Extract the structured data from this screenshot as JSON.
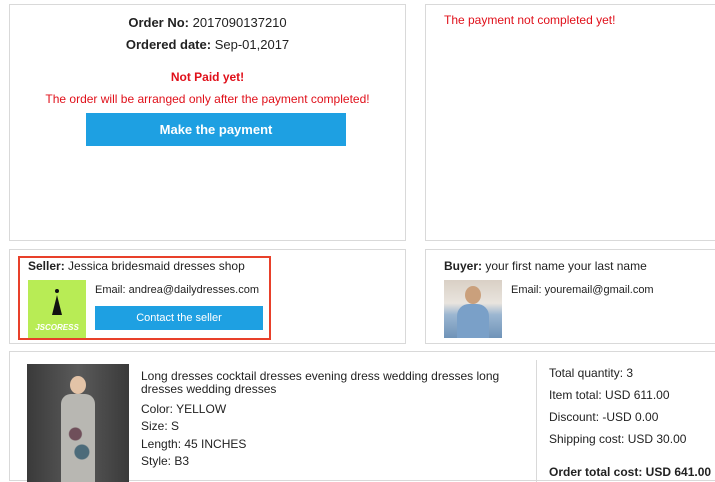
{
  "order": {
    "order_no_label": "Order No:",
    "order_no": "2017090137210",
    "ordered_date_label": "Ordered date:",
    "ordered_date": "Sep-01,2017",
    "not_paid": "Not Paid yet!",
    "arrange_note": "The order will be arranged only after the payment completed!",
    "pay_button": "Make the payment"
  },
  "status": {
    "text": "The payment not completed yet!"
  },
  "seller": {
    "label": "Seller:",
    "name": "Jessica bridesmaid dresses shop",
    "logo_text": "JSCORESS",
    "email_label": "Email:",
    "email": "andrea@dailydresses.com",
    "contact_button": "Contact the seller"
  },
  "buyer": {
    "label": "Buyer:",
    "name": "your first name your last name",
    "email_label": "Email:",
    "email": "youremail@gmail.com"
  },
  "item": {
    "title": "Long dresses cocktail dresses evening dress wedding dresses long dresses wedding dresses",
    "color": "Color: YELLOW",
    "size": "Size: S",
    "length": "Length: 45 INCHES",
    "style": "Style: B3"
  },
  "summary": {
    "total_quantity": "Total quantity: 3",
    "item_total": "Item total: USD 611.00",
    "discount": "Discount: -USD 0.00",
    "shipping_cost": "Shipping cost: USD 30.00",
    "order_total": "Order total cost: USD 641.00"
  },
  "colors": {
    "accent": "#1ea0e2",
    "alert": "#e0101a",
    "highlight_border": "#e8402a",
    "seller_logo_bg": "#b8ec55"
  },
  "icons": {
    "seller_logo": "dress-silhouette-logo",
    "buyer_avatar": "buyer-photo",
    "product_image": "dress-product-photo"
  }
}
